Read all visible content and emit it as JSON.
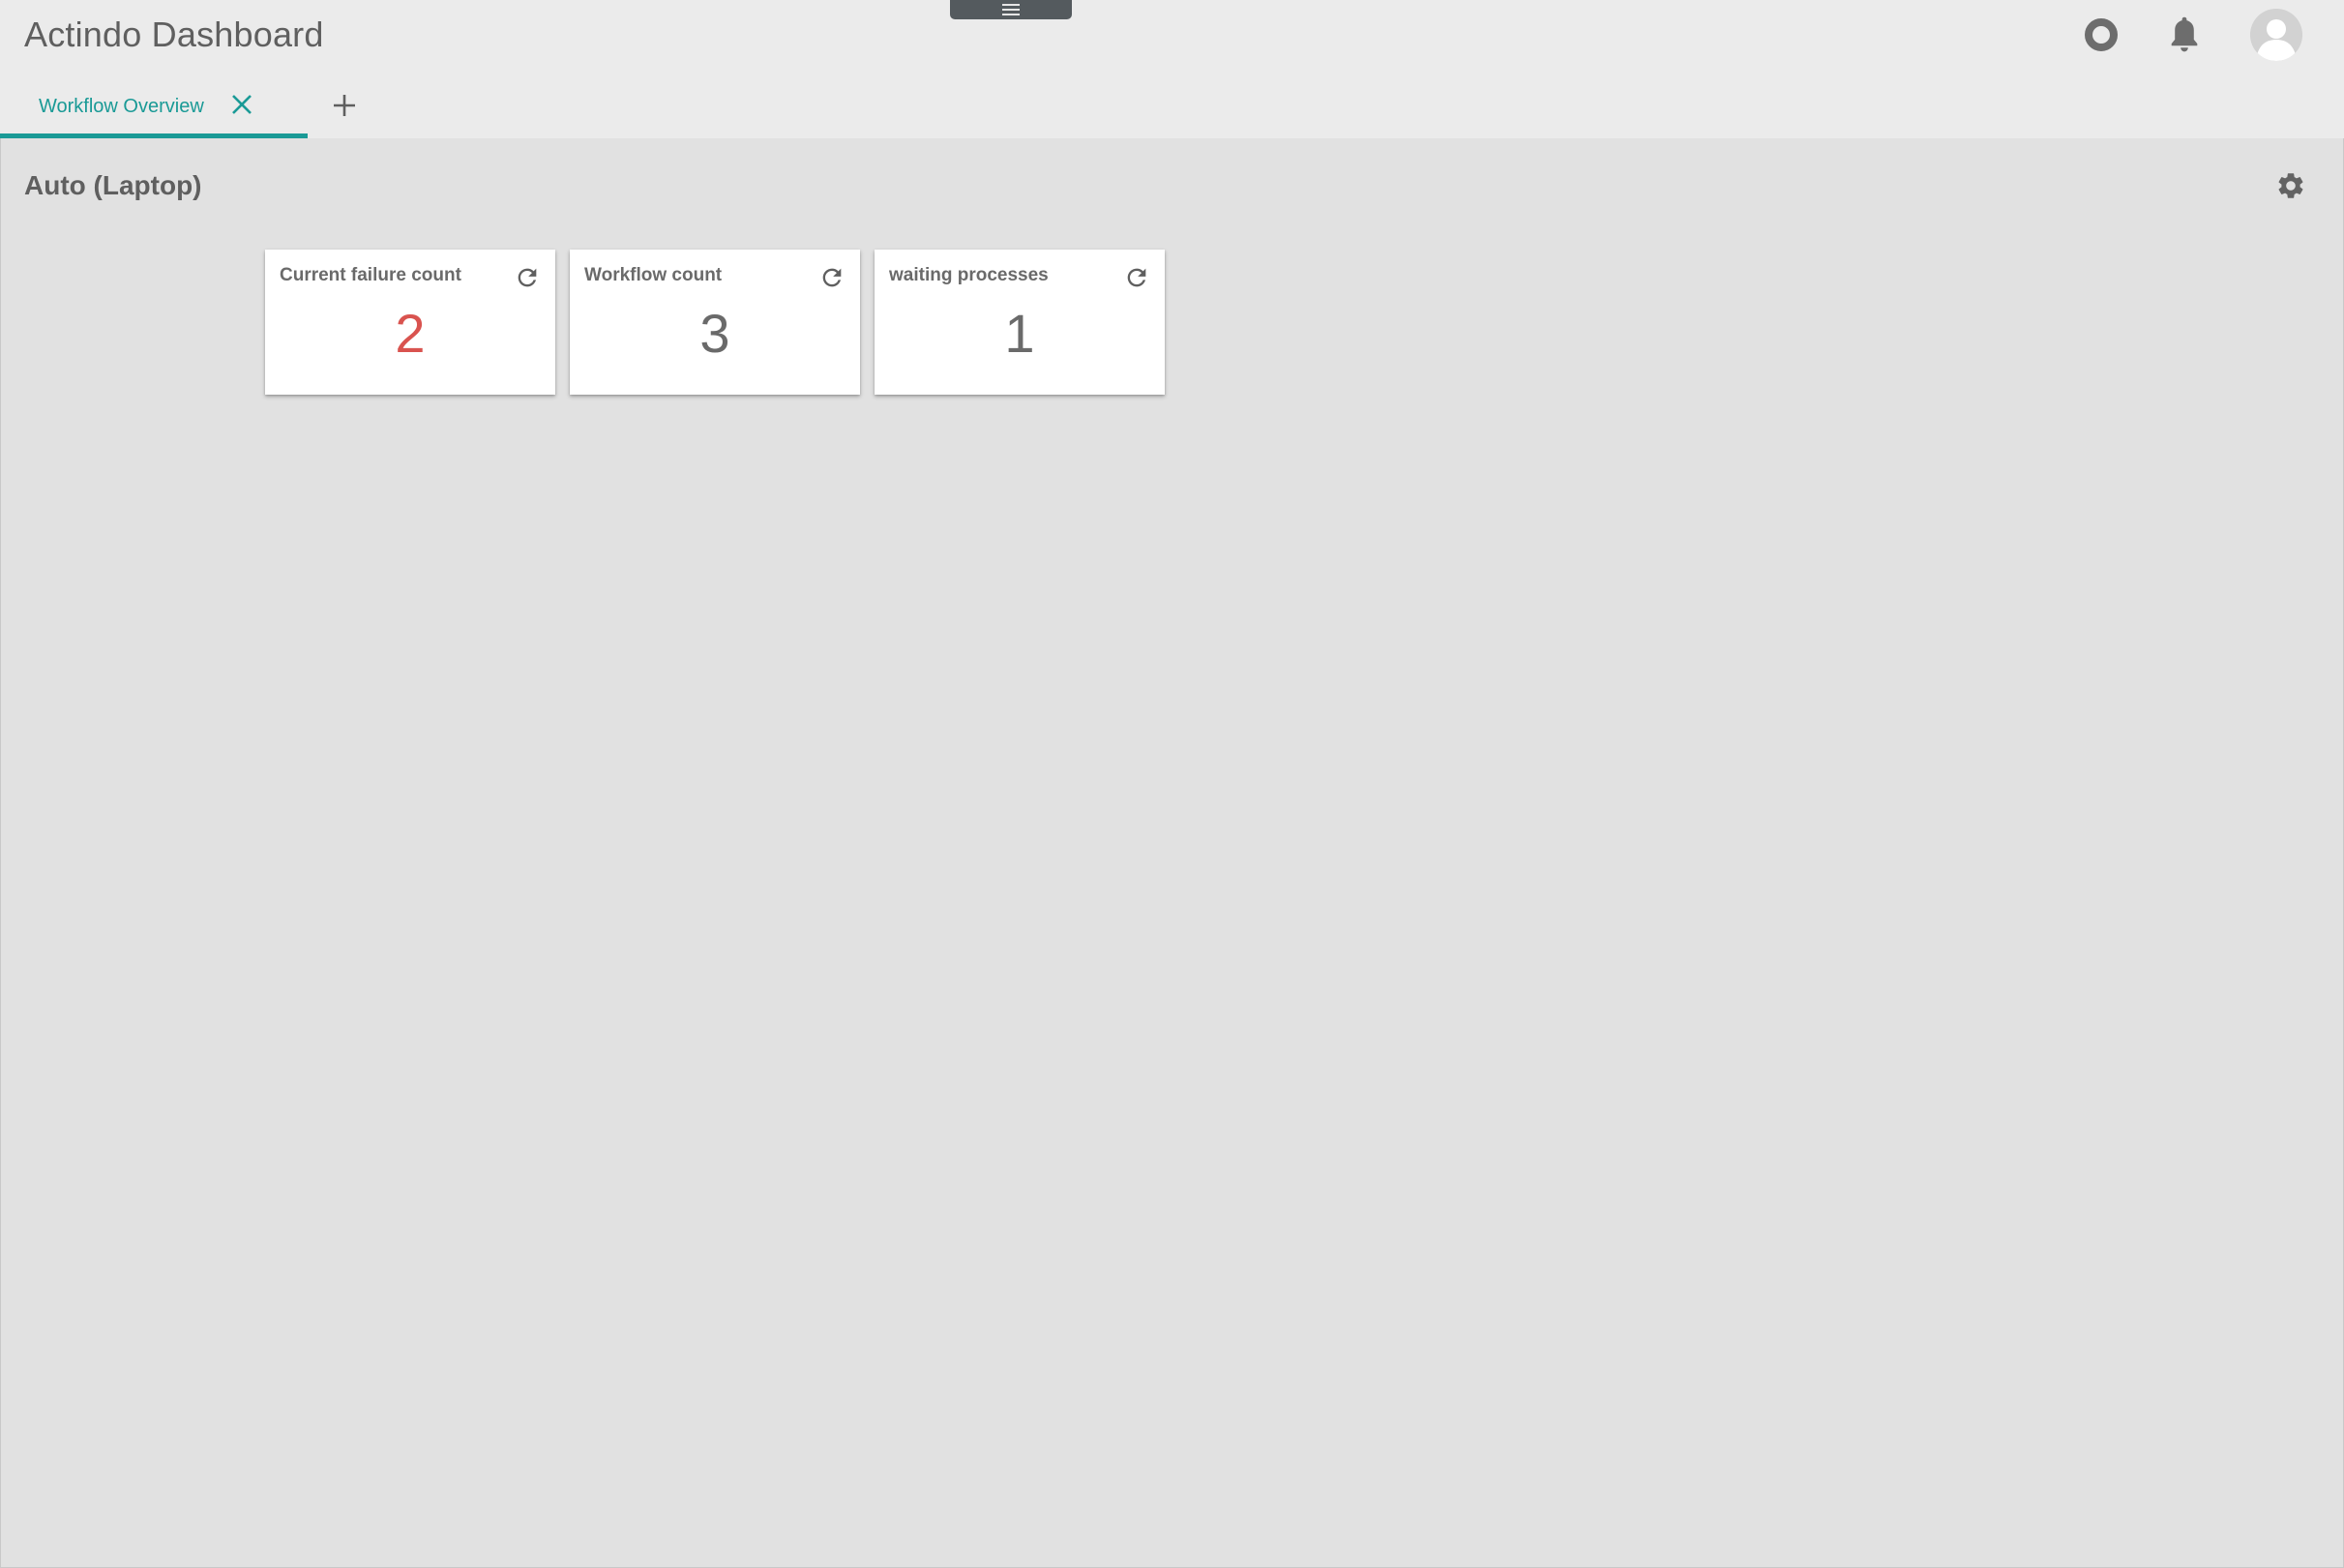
{
  "header": {
    "app_title": "Actindo Dashboard",
    "icons": [
      "menu-icon",
      "status-circle-icon",
      "bell-icon",
      "user-avatar-icon"
    ]
  },
  "tabs": {
    "items": [
      {
        "label": "Workflow Overview",
        "active": true
      }
    ],
    "add_icon": "plus-icon"
  },
  "content": {
    "section_title": "Auto (Laptop)",
    "settings_icon": "gear-icon",
    "widgets": [
      {
        "title": "Current failure count",
        "value": "2",
        "value_color": "#d9534f"
      },
      {
        "title": "Workflow count",
        "value": "3",
        "value_color": "#6a6a6a"
      },
      {
        "title": "waiting processes",
        "value": "1",
        "value_color": "#6a6a6a"
      }
    ]
  },
  "colors": {
    "accent": "#1a9a96",
    "alert": "#d9534f",
    "background": "#e1e1e1",
    "header_bg": "#ebebeb",
    "text": "#5f5f5f"
  }
}
